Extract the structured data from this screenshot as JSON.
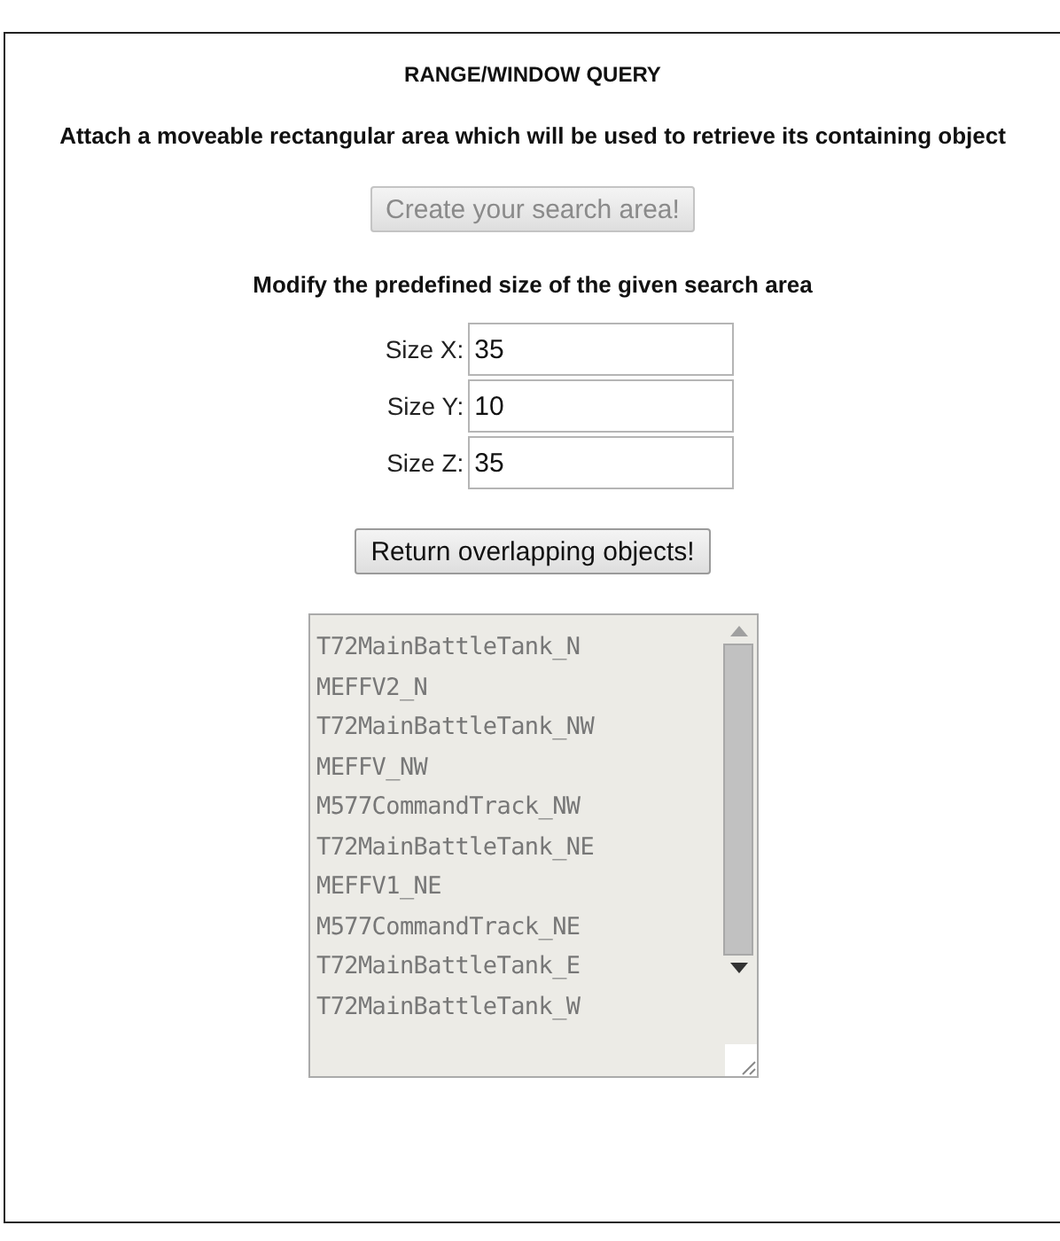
{
  "title": "RANGE/WINDOW QUERY",
  "description": "Attach a moveable rectangular area which will be used to retrieve its containing object",
  "create_button": {
    "label": "Create your search area!",
    "disabled": true
  },
  "size_heading": "Modify the predefined size of the given search area",
  "size_fields": [
    {
      "label": "Size X:",
      "value": "35"
    },
    {
      "label": "Size Y:",
      "value": "10"
    },
    {
      "label": "Size Z:",
      "value": "35"
    }
  ],
  "return_button": {
    "label": "Return overlapping objects!",
    "disabled": false
  },
  "results": {
    "disabled": true,
    "items": [
      "T72MainBattleTank_N",
      "MEFFV2_N",
      "T72MainBattleTank_NW",
      "MEFFV_NW",
      "M577CommandTrack_NW",
      "T72MainBattleTank_NE",
      "MEFFV1_NE",
      "M577CommandTrack_NE",
      "T72MainBattleTank_E",
      "T72MainBattleTank_W"
    ]
  }
}
